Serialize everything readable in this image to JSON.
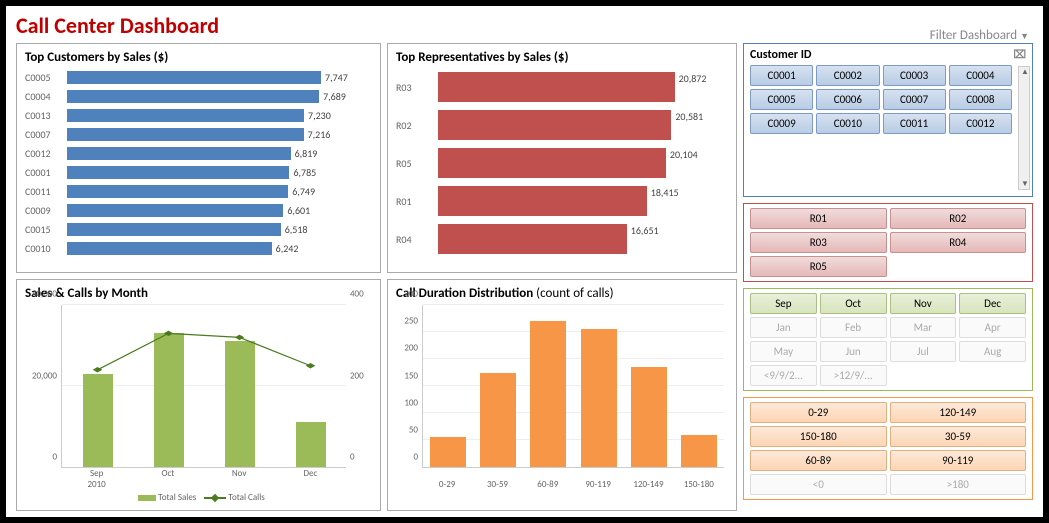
{
  "title": "Call Center Dashboard",
  "filter_link": "Filter Dashboard",
  "panels": {
    "top_customers": {
      "title": "Top Customers by Sales ($)"
    },
    "top_reps": {
      "title": "Top Representatives by Sales ($)"
    },
    "sales_calls": {
      "title": "Sales & Calls by Month",
      "legend": {
        "sales": "Total Sales",
        "calls": "Total Calls"
      }
    },
    "call_dur": {
      "title": "Call Duration Distribution",
      "subtitle": "(count of calls)"
    }
  },
  "filters": {
    "customer": {
      "title": "Customer ID",
      "items": [
        "C0001",
        "C0002",
        "C0003",
        "C0004",
        "C0005",
        "C0006",
        "C0007",
        "C0008",
        "C0009",
        "C0010",
        "C0011",
        "C0012"
      ]
    },
    "rep": {
      "items": [
        "R01",
        "R02",
        "R03",
        "R04",
        "R05"
      ]
    },
    "month": {
      "active": [
        "Sep",
        "Oct",
        "Nov",
        "Dec"
      ],
      "inactive": [
        "Jan",
        "Feb",
        "Mar",
        "Apr",
        "May",
        "Jun",
        "Jul",
        "Aug",
        "<9/9/2...",
        ">12/9/..."
      ]
    },
    "duration": {
      "active": [
        "0-29",
        "120-149",
        "150-180",
        "30-59",
        "60-89",
        "90-119"
      ],
      "inactive": [
        "<0",
        ">180"
      ]
    }
  },
  "chart_data": [
    {
      "id": "top_customers",
      "type": "bar",
      "orientation": "horizontal",
      "title": "Top Customers by Sales ($)",
      "categories": [
        "C0005",
        "C0004",
        "C0013",
        "C0007",
        "C0012",
        "C0001",
        "C0011",
        "C0009",
        "C0015",
        "C0010"
      ],
      "values": [
        7747,
        7689,
        7230,
        7216,
        6819,
        6785,
        6749,
        6601,
        6518,
        6242
      ],
      "color": "#4f81bd"
    },
    {
      "id": "top_reps",
      "type": "bar",
      "orientation": "horizontal",
      "title": "Top Representatives by Sales ($)",
      "categories": [
        "R03",
        "R02",
        "R05",
        "R01",
        "R04"
      ],
      "values": [
        20872,
        20581,
        20104,
        18415,
        16651
      ],
      "color": "#c0504d"
    },
    {
      "id": "sales_calls",
      "type": "bar+line",
      "title": "Sales & Calls by Month",
      "x": [
        "Sep 2010",
        "Oct",
        "Nov",
        "Dec"
      ],
      "series": [
        {
          "name": "Total Sales",
          "type": "bar",
          "axis": "left",
          "values": [
            23000,
            33000,
            31000,
            11000
          ],
          "color": "#9bbb59"
        },
        {
          "name": "Total Calls",
          "type": "line",
          "axis": "right",
          "values": [
            240,
            330,
            320,
            250
          ],
          "color": "#4a7b1e"
        }
      ],
      "ylim_left": [
        0,
        40000
      ],
      "ylim_right": [
        0,
        400
      ],
      "xlabel": "",
      "ylabel": ""
    },
    {
      "id": "call_duration",
      "type": "bar",
      "title": "Call Duration Distribution (count of calls)",
      "categories": [
        "0-29",
        "30-59",
        "60-89",
        "90-119",
        "120-149",
        "150-180"
      ],
      "values": [
        55,
        175,
        270,
        255,
        185,
        60
      ],
      "ylim": [
        0,
        300
      ],
      "color": "#f79646"
    }
  ],
  "axes": {
    "sales_calls_left": [
      "0",
      "20,000",
      "40,000"
    ],
    "sales_calls_right": [
      "0",
      "200",
      "400"
    ],
    "call_dur_y": [
      "0",
      "50",
      "100",
      "150",
      "200",
      "250",
      "300"
    ]
  }
}
